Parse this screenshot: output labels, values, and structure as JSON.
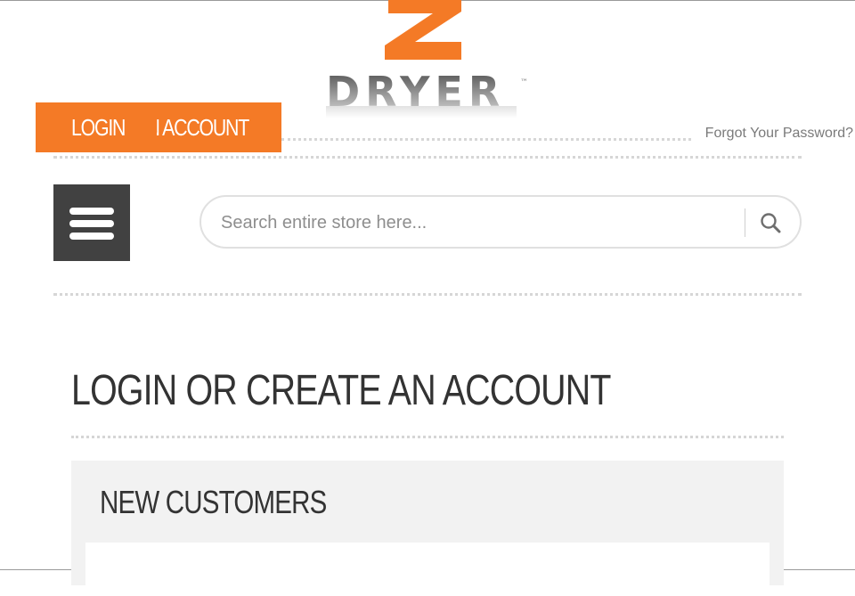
{
  "brand": {
    "logo_letter": "Z",
    "logo_word": "DRYER",
    "trademark": "™",
    "colors": {
      "orange": "#f47a26",
      "dark": "#414141"
    }
  },
  "auth": {
    "login_label": "LOGIN",
    "account_label": "N ACCOUNT",
    "forgot_password": "Forgot Your Password?"
  },
  "toolbar": {
    "menu_icon": "hamburger-menu-icon",
    "search_placeholder": "Search entire store here...",
    "search_value": "",
    "search_icon": "search-icon"
  },
  "main": {
    "page_title": "LOGIN OR CREATE AN ACCOUNT",
    "new_customers_title": "NEW CUSTOMERS"
  }
}
